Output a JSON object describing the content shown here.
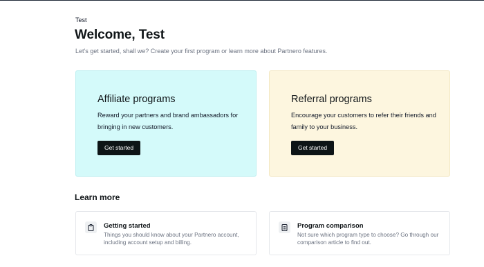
{
  "header": {
    "workspace": "Test",
    "title": "Welcome, Test",
    "subtitle": "Let's get started, shall we? Create your first program or learn more about Partnero features."
  },
  "programs": {
    "affiliate": {
      "title": "Affiliate programs",
      "description": "Reward your partners and brand ambassadors for bringing in new customers.",
      "button": "Get started",
      "bg_color": "#d4fafa"
    },
    "referral": {
      "title": "Referral programs",
      "description": "Encourage your customers to refer their friends and family to your business.",
      "button": "Get started",
      "bg_color": "#fdf6df"
    }
  },
  "learn_more": {
    "title": "Learn more",
    "items": [
      {
        "title": "Getting started",
        "description": "Things you should know about your Partnero account, including account setup and billing.",
        "icon": "clipboard-icon"
      },
      {
        "title": "Program comparison",
        "description": "Not sure which program type to choose? Go through our comparison article to find out.",
        "icon": "document-icon"
      }
    ]
  },
  "colors": {
    "button": "#0d1416",
    "muted_text": "#6b7280"
  }
}
